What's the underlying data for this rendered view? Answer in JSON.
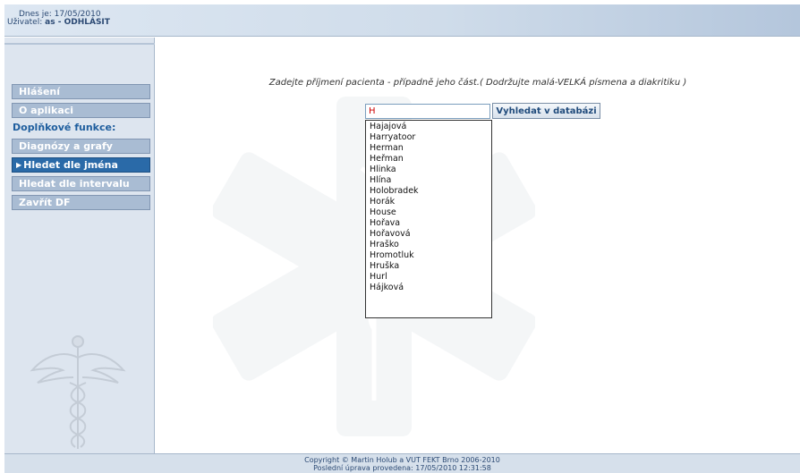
{
  "header": {
    "date_label": "Dnes je:",
    "date_value": "17/05/2010",
    "user_label": "Uživatel:",
    "user_value": "as",
    "user_sep": " - ",
    "logout_label": "ODHLÁSIT"
  },
  "sidebar": {
    "items": [
      {
        "label": "Hlášení"
      },
      {
        "label": "O aplikaci"
      },
      {
        "label": "Doplňkové funkce:"
      },
      {
        "label": "Diagnózy a grafy"
      },
      {
        "label": "Hledet dle jména"
      },
      {
        "label": "Hledat dle intervalu"
      },
      {
        "label": "Zavřít DF"
      }
    ],
    "active_index": 4
  },
  "main": {
    "instruction": "Zadejte příjmení pacienta - případně jeho část.( Dodržujte malá-VELKÁ písmena a diakritiku )",
    "search_value": "H",
    "search_button": "Vyhledat v databázi",
    "suggestions": [
      "Hajajová",
      "Harryatoor",
      "Herman",
      "Heřman",
      "Hlinka",
      "Hlína",
      "Holobradek",
      "Horák",
      "House",
      "Hořava",
      "Hořavová",
      "Hraško",
      "Hromotluk",
      "Hruška",
      "Hurl",
      "Hájková"
    ]
  },
  "footer": {
    "copyright": "Copyright © Martin Holub a VUT FEKT Brno 2006-2010",
    "last_update": "Poslední úprava provedena: 17/05/2010 12:31:58"
  },
  "colors": {
    "accent": "#2a6aa8",
    "nav_bg": "#a9bcd3",
    "sidebar_bg": "#dde5ef"
  },
  "icons": {
    "logo": "caduceus-icon",
    "watermark": "star-of-life-icon",
    "active_marker": "triangle-right-icon"
  }
}
